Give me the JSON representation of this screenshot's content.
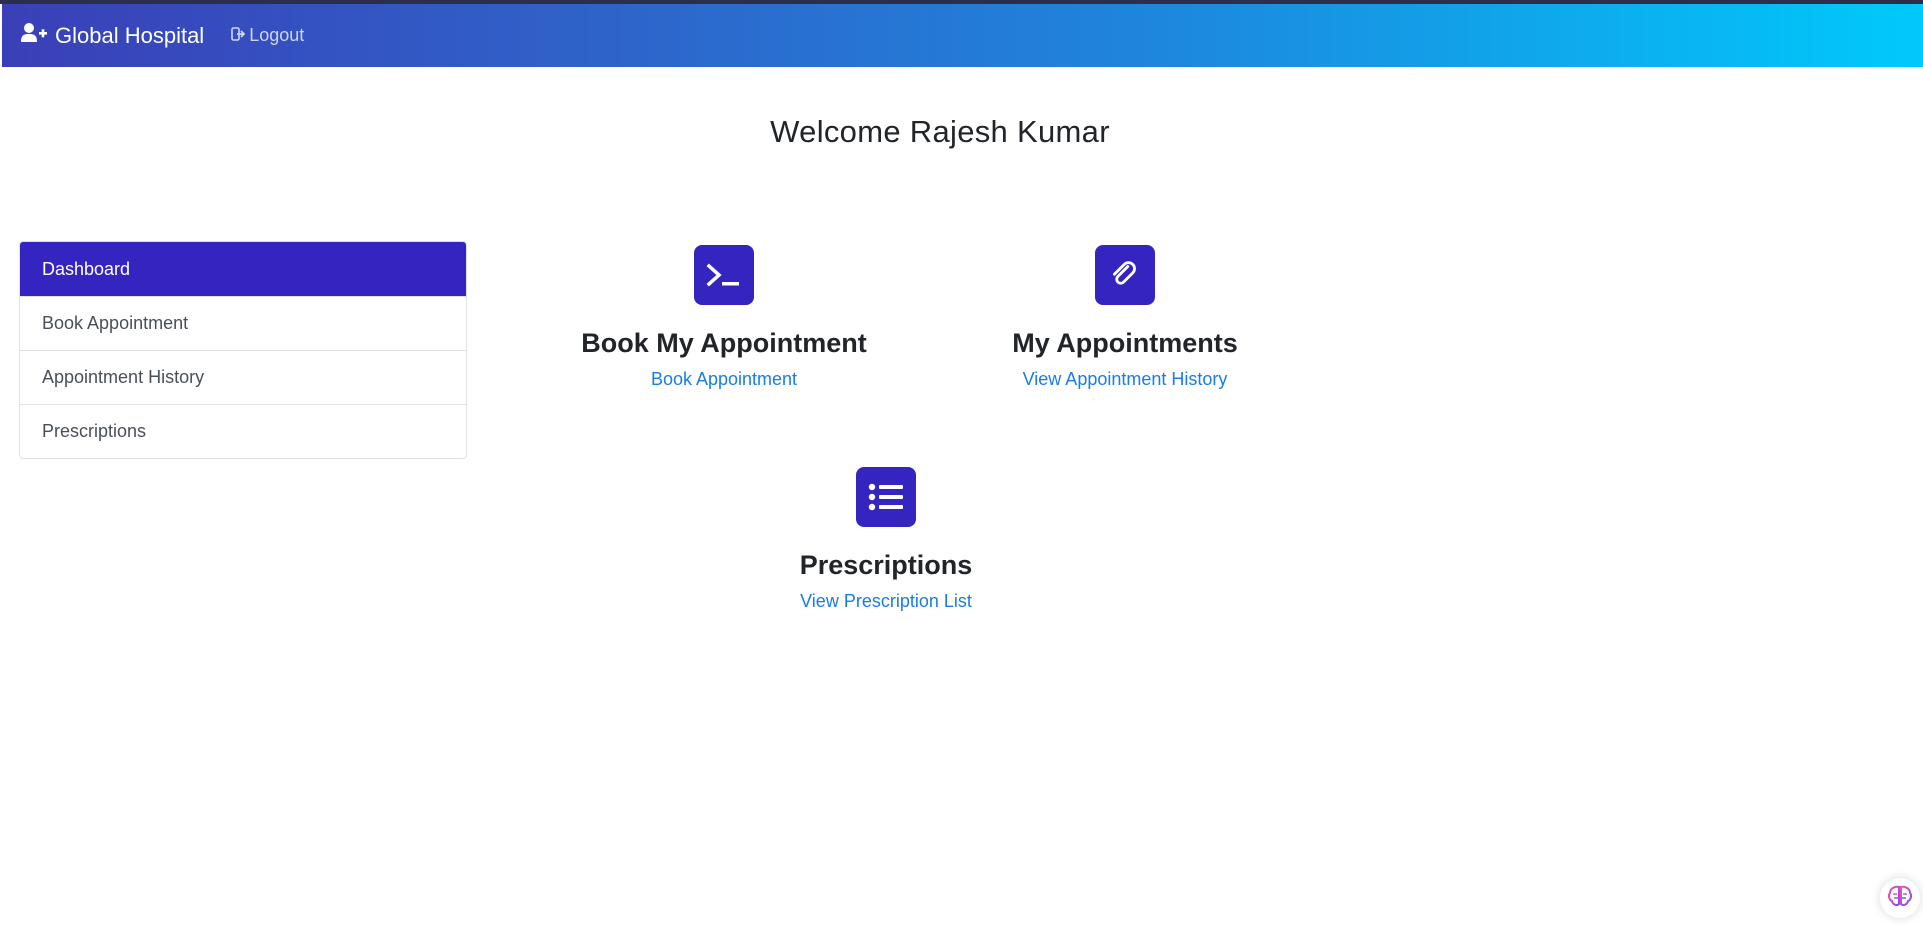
{
  "navbar": {
    "brand_icon": "user-plus-icon",
    "brand": "Global Hospital",
    "logout_icon": "sign-out-icon",
    "logout": "Logout"
  },
  "welcome": "Welcome  Rajesh Kumar",
  "sidebar": {
    "items": [
      {
        "label": "Dashboard",
        "active": true
      },
      {
        "label": "Book Appointment",
        "active": false
      },
      {
        "label": "Appointment History",
        "active": false
      },
      {
        "label": "Prescriptions",
        "active": false
      }
    ]
  },
  "cards": [
    {
      "icon": "terminal-icon",
      "title": "Book My Appointment",
      "link": "Book Appointment"
    },
    {
      "icon": "paperclip-icon",
      "title": "My Appointments",
      "link": "View Appointment History"
    },
    {
      "icon": "list-icon",
      "title": "Prescriptions",
      "link": "View Prescription List"
    }
  ],
  "colors": {
    "accent": "#3525c0",
    "link": "#1a7ce6",
    "navbar_gradient_start": "#3a3fb8",
    "navbar_gradient_end": "#00c9fb"
  },
  "floating_button_icon": "brain-icon"
}
